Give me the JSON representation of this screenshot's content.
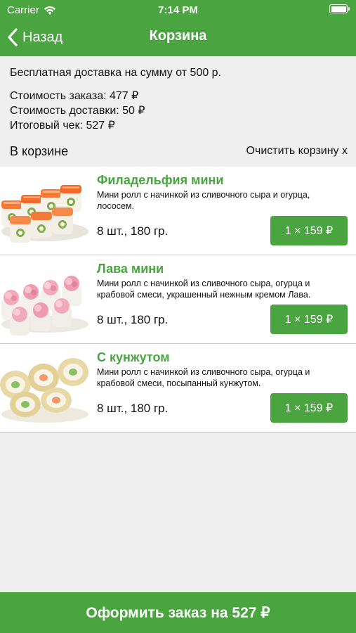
{
  "status": {
    "carrier": "Carrier",
    "time": "7:14 PM"
  },
  "nav": {
    "back_label": "Назад",
    "title": "Корзина"
  },
  "summary": {
    "free_delivery": "Бесплатная доставка на сумму от 500 р.",
    "order_cost": "Стоимость заказа: 477 ₽",
    "delivery_cost": "Стоимость доставки: 50 ₽",
    "total": "Итоговый чек: 527 ₽"
  },
  "cart": {
    "header": "В корзине",
    "clear_label": "Очистить корзину x"
  },
  "items": [
    {
      "name": "Филадельфия мини",
      "description": "Мини ролл с начинкой из сливочного сыра и огурца, лососем.",
      "weight": "8 шт., 180 гр.",
      "qty_label": "1 × 159 ₽"
    },
    {
      "name": "Лава мини",
      "description": "Мини ролл с начинкой из сливочного сыра,  огурца и крабовой смеси, украшенный нежным кремом Лава.",
      "weight": "8 шт., 180 гр.",
      "qty_label": "1 × 159 ₽"
    },
    {
      "name": "С кунжутом",
      "description": "Мини ролл с начинкой из сливочного сыра, огурца и крабовой смеси, посыпанный кунжутом.",
      "weight": "8 шт., 180 гр.",
      "qty_label": "1 × 159 ₽"
    }
  ],
  "checkout_label": "Оформить заказ на 527 ₽",
  "colors": {
    "accent": "#4aa541",
    "background": "#efefef"
  }
}
